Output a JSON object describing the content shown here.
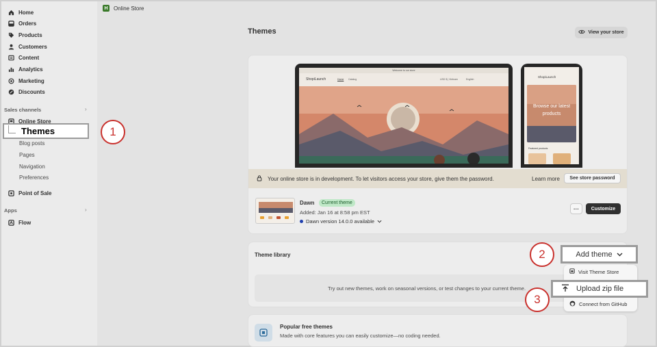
{
  "sidebar": {
    "items": [
      {
        "label": "Home",
        "icon": "home-icon"
      },
      {
        "label": "Orders",
        "icon": "orders-icon"
      },
      {
        "label": "Products",
        "icon": "tag-icon"
      },
      {
        "label": "Customers",
        "icon": "person-icon"
      },
      {
        "label": "Content",
        "icon": "content-icon"
      },
      {
        "label": "Analytics",
        "icon": "bar-chart-icon"
      },
      {
        "label": "Marketing",
        "icon": "target-icon"
      },
      {
        "label": "Discounts",
        "icon": "discount-icon"
      }
    ],
    "sales_channels_label": "Sales channels",
    "online_store": "Online Store",
    "themes": "Themes",
    "sub_items": [
      "Blog posts",
      "Pages",
      "Navigation",
      "Preferences"
    ],
    "point_of_sale": "Point of Sale",
    "apps_label": "Apps",
    "flow": "Flow",
    "chevron": "›"
  },
  "topbar": {
    "title": "Online Store",
    "logo_letter": "H"
  },
  "page": {
    "title": "Themes",
    "view_store": "View your store"
  },
  "preview": {
    "dev_banner": "Your online store is in development. To let visitors access your store, give them the password.",
    "learn_more": "Learn more",
    "see_password": "See store password",
    "laptop": {
      "announce": "Welcome to our store",
      "brand": "ShopiLaunch",
      "nav1": "Home",
      "nav2": "Catalog",
      "currency": "USD $ | Vietnam",
      "lang": "English"
    },
    "phone": {
      "brand": "ShopiLaunch",
      "hero": "Browse our latest products",
      "featured": "Featured products"
    }
  },
  "current_theme": {
    "name": "Dawn",
    "badge": "Current theme",
    "added": "Added: Jan 16 at 8:58 pm EST",
    "version": "Dawn version 14.0.0 available",
    "more": "···",
    "customize": "Customize"
  },
  "library": {
    "title": "Theme library",
    "empty_text": "Try out new themes, work on seasonal versions, or test changes to your current theme."
  },
  "add_theme": {
    "label": "Add theme",
    "menu": {
      "visit": "Visit Theme Store",
      "upload": "Upload zip file",
      "github": "Connect from GitHub"
    }
  },
  "popular": {
    "title": "Popular free themes",
    "subtitle": "Made with core features you can easily customize—no coding needed."
  },
  "steps": [
    "1",
    "2",
    "3"
  ],
  "colors": {
    "accent": "#c9302c",
    "badge": "#bfe8c7",
    "primary_button": "#303030"
  }
}
